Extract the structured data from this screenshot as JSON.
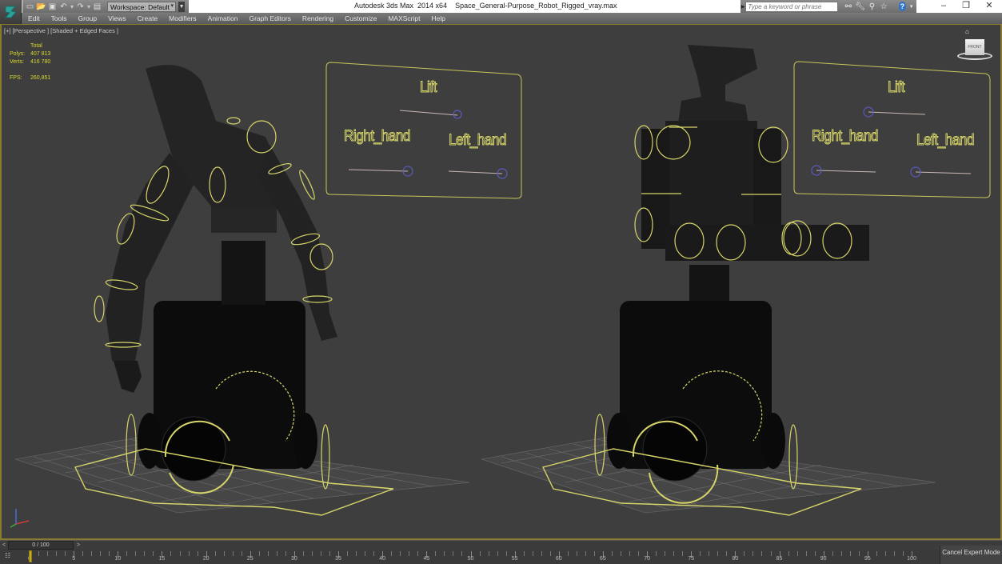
{
  "app": {
    "title": "Autodesk 3ds Max  2014 x64",
    "file_name": "Space_General-Purpose_Robot_Rigged_vray.max"
  },
  "quick_access": {
    "workspace_label": "Workspace: Default",
    "icons": [
      "new-file-icon",
      "open-folder-icon",
      "save-icon",
      "undo-icon",
      "redo-icon",
      "project-folder-icon"
    ]
  },
  "search": {
    "placeholder": "Type a keyword or phrase",
    "icons": [
      "binoculars-icon",
      "wrench-icon",
      "satellite-icon",
      "star-icon",
      "help-icon"
    ]
  },
  "window_controls": {
    "minimize": "–",
    "restore": "❐",
    "close": "✕"
  },
  "menu": {
    "items": [
      "Edit",
      "Tools",
      "Group",
      "Views",
      "Create",
      "Modifiers",
      "Animation",
      "Graph Editors",
      "Rendering",
      "Customize",
      "MAXScript",
      "Help"
    ]
  },
  "viewport": {
    "label": "[+] [Perspective ] [Shaded + Edged Faces ]",
    "stats": {
      "header": "Total",
      "polys_label": "Polys:",
      "polys": "407 813",
      "verts_label": "Verts:",
      "verts": "416 780",
      "fps_label": "FPS:",
      "fps": "260,851"
    },
    "viewcube_label": "FRONT",
    "control_panels": [
      {
        "id": "left",
        "labels": {
          "lift": "Lift",
          "right_hand": "Right_hand",
          "left_hand": "Left_hand"
        },
        "slider_values": {
          "lift": 1.0,
          "right_hand": 1.0,
          "left_hand": 1.0
        }
      },
      {
        "id": "right",
        "labels": {
          "lift": "Lift",
          "right_hand": "Right_hand",
          "left_hand": "Left_hand"
        },
        "slider_values": {
          "lift": 0.0,
          "right_hand": 0.0,
          "left_hand": 0.0
        }
      }
    ]
  },
  "time_slider": {
    "prev": "<",
    "next": ">",
    "current_frame": 0,
    "total_frames": 100,
    "display": "0 / 100"
  },
  "trackbar": {
    "tick_labels": [
      "0",
      "5",
      "10",
      "15",
      "20",
      "25",
      "30",
      "35",
      "40",
      "45",
      "50",
      "55",
      "60",
      "65",
      "70",
      "75",
      "80",
      "85",
      "90",
      "95",
      "100"
    ]
  },
  "status": {
    "cancel_expert_mode": "Cancel Expert Mode"
  },
  "colors": {
    "viewport_bg": "#3e3e3e",
    "active_border": "#8a7a30",
    "control_yellow": "#d7d56a",
    "slider_handle": "#4a4aa0",
    "stats_text": "#d8d830"
  }
}
